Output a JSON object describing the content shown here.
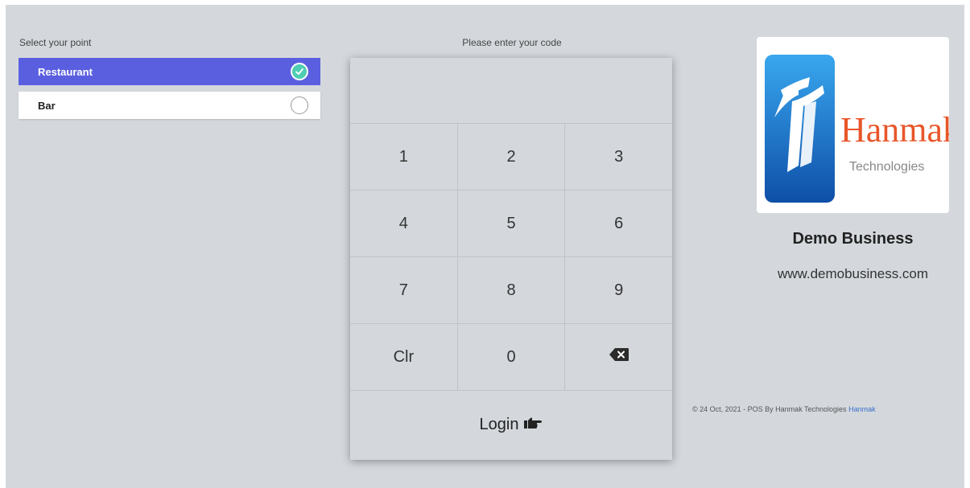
{
  "left_panel": {
    "title": "Select your point",
    "points": [
      {
        "label": "Restaurant",
        "selected": true
      },
      {
        "label": "Bar",
        "selected": false
      }
    ]
  },
  "keypad": {
    "title": "Please enter your code",
    "code_value": "",
    "keys": [
      "1",
      "2",
      "3",
      "4",
      "5",
      "6",
      "7",
      "8",
      "9",
      "Clr",
      "0"
    ],
    "backspace_icon": "backspace-icon",
    "login_label": "Login",
    "login_icon": "hand-pointing-right-icon"
  },
  "right_panel": {
    "logo": {
      "brand": "Hanmak",
      "sub": "Technologies"
    },
    "business_name": "Demo Business",
    "website": "www.demobusiness.com",
    "footer_text": "© 24 Oct, 2021 - POS By Hanmak Technologies",
    "footer_link": "Hanmak"
  },
  "colors": {
    "background": "#d4d8dd",
    "selected": "#5a5fe0",
    "check": "#4ecdb3",
    "brand_orange": "#e8562a",
    "brand_blue": "#1a6fcf",
    "link": "#3b6fc9"
  }
}
